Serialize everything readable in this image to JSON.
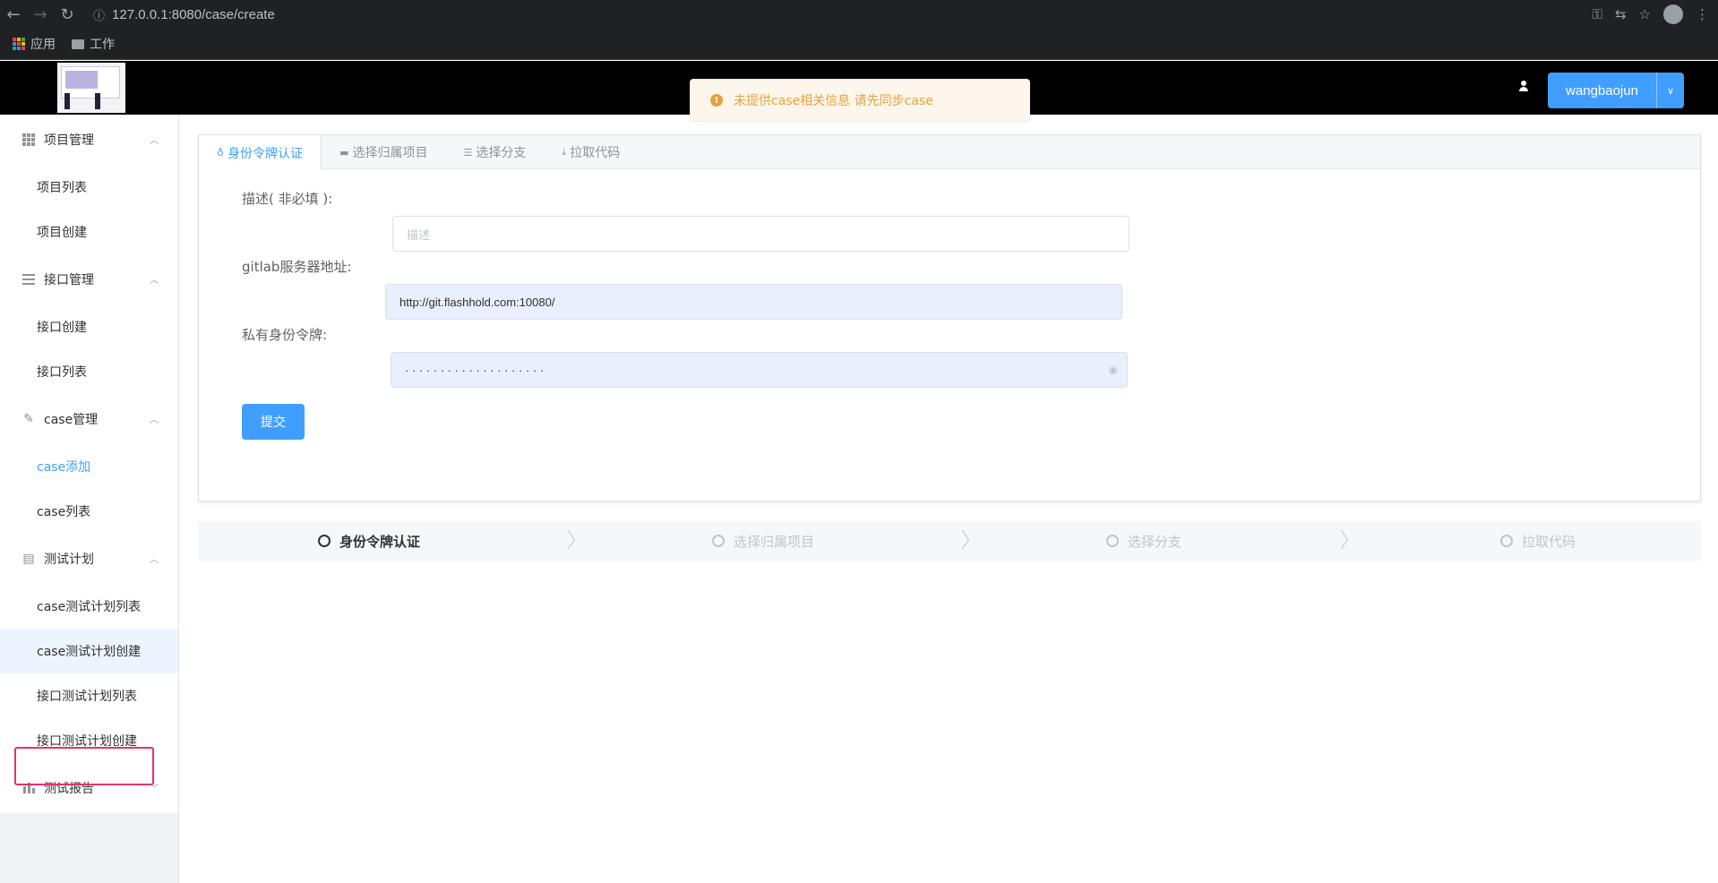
{
  "browser": {
    "url": "127.0.0.1:8080/case/create",
    "bookmarks": [
      "应用",
      "工作"
    ]
  },
  "header": {
    "username": "wangbaojun",
    "notice": "未提供case相关信息 请先同步case"
  },
  "sidebar": {
    "groups": [
      {
        "label": "项目管理",
        "items": [
          "项目列表",
          "项目创建"
        ]
      },
      {
        "label": "接口管理",
        "items": [
          "接口创建",
          "接口列表"
        ]
      },
      {
        "label": "case管理",
        "items": [
          "case添加",
          "case列表"
        ]
      },
      {
        "label": "测试计划",
        "items": [
          "case测试计划列表",
          "case测试计划创建",
          "接口测试计划列表",
          "接口测试计划创建"
        ]
      },
      {
        "label": "测试报告",
        "items": []
      }
    ]
  },
  "tabs": [
    "身份令牌认证",
    "选择归属项目",
    "选择分支",
    "拉取代码"
  ],
  "form": {
    "desc_label": "描述( 非必填 ):",
    "desc_placeholder": "描述",
    "gitlab_label": "gitlab服务器地址:",
    "gitlab_value": "http://git.flashhold.com:10080/",
    "token_label": "私有身份令牌:",
    "token_value": "· · · · · · · · · · · · · · · · · · · ·",
    "submit_label": "提交"
  },
  "steps": [
    "身份令牌认证",
    "选择归属项目",
    "选择分支",
    "拉取代码"
  ],
  "colors": {
    "primary": "#409eff",
    "warning": "#e6a23c",
    "highlight_border": "#e5326a"
  }
}
